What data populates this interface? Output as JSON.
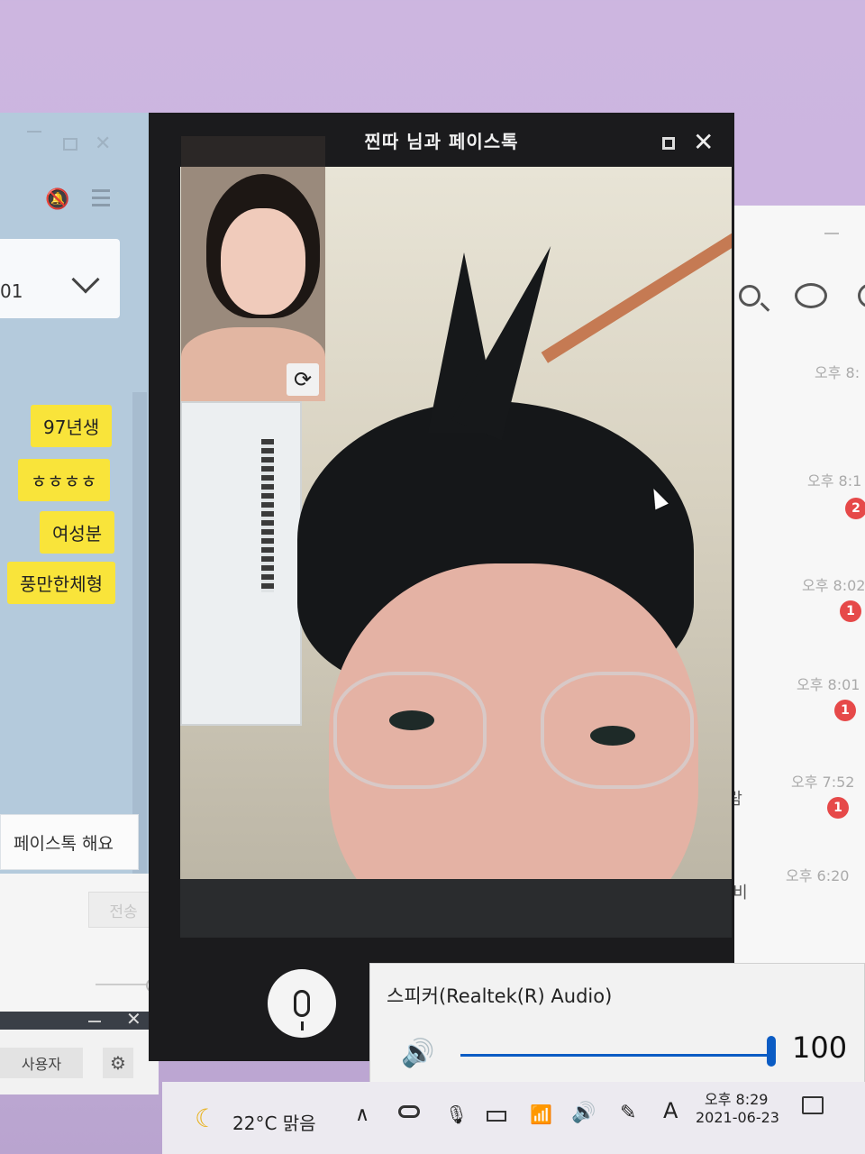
{
  "chat_window": {
    "dropdown_value": "01",
    "messages": [
      "97년생",
      "ㅎㅎㅎㅎ",
      "여성분",
      "풍만한체형"
    ],
    "facetalk_button": "페이스톡 해요",
    "send_label": "전송"
  },
  "user_window": {
    "user_label": "사용자"
  },
  "call_window": {
    "title": "찐따 님과 페이스톡"
  },
  "chat_list": {
    "items": [
      {
        "time": "오후 8:",
        "badge": "",
        "preview": ""
      },
      {
        "time": "오후 8:1",
        "badge": "2",
        "preview": ""
      },
      {
        "time": "오후 8:02",
        "badge": "1",
        "preview": ""
      },
      {
        "time": "오후 8:01",
        "badge": "1",
        "preview": ""
      },
      {
        "time": "오후 7:52",
        "badge": "1",
        "preview": "l 알람"
      },
      {
        "time": "오후 6:20",
        "badge": "",
        "preview": "가서비"
      }
    ]
  },
  "volume_popup": {
    "device": "스피커(Realtek(R) Audio)",
    "value": "100",
    "level_percent": 100
  },
  "taskbar": {
    "weather": "22°C 맑음",
    "ime": "A",
    "time": "오후 8:29",
    "date": "2021-06-23"
  },
  "colors": {
    "bubble": "#f9e43a",
    "badge": "#e64949",
    "accent": "#0b5cc4"
  }
}
